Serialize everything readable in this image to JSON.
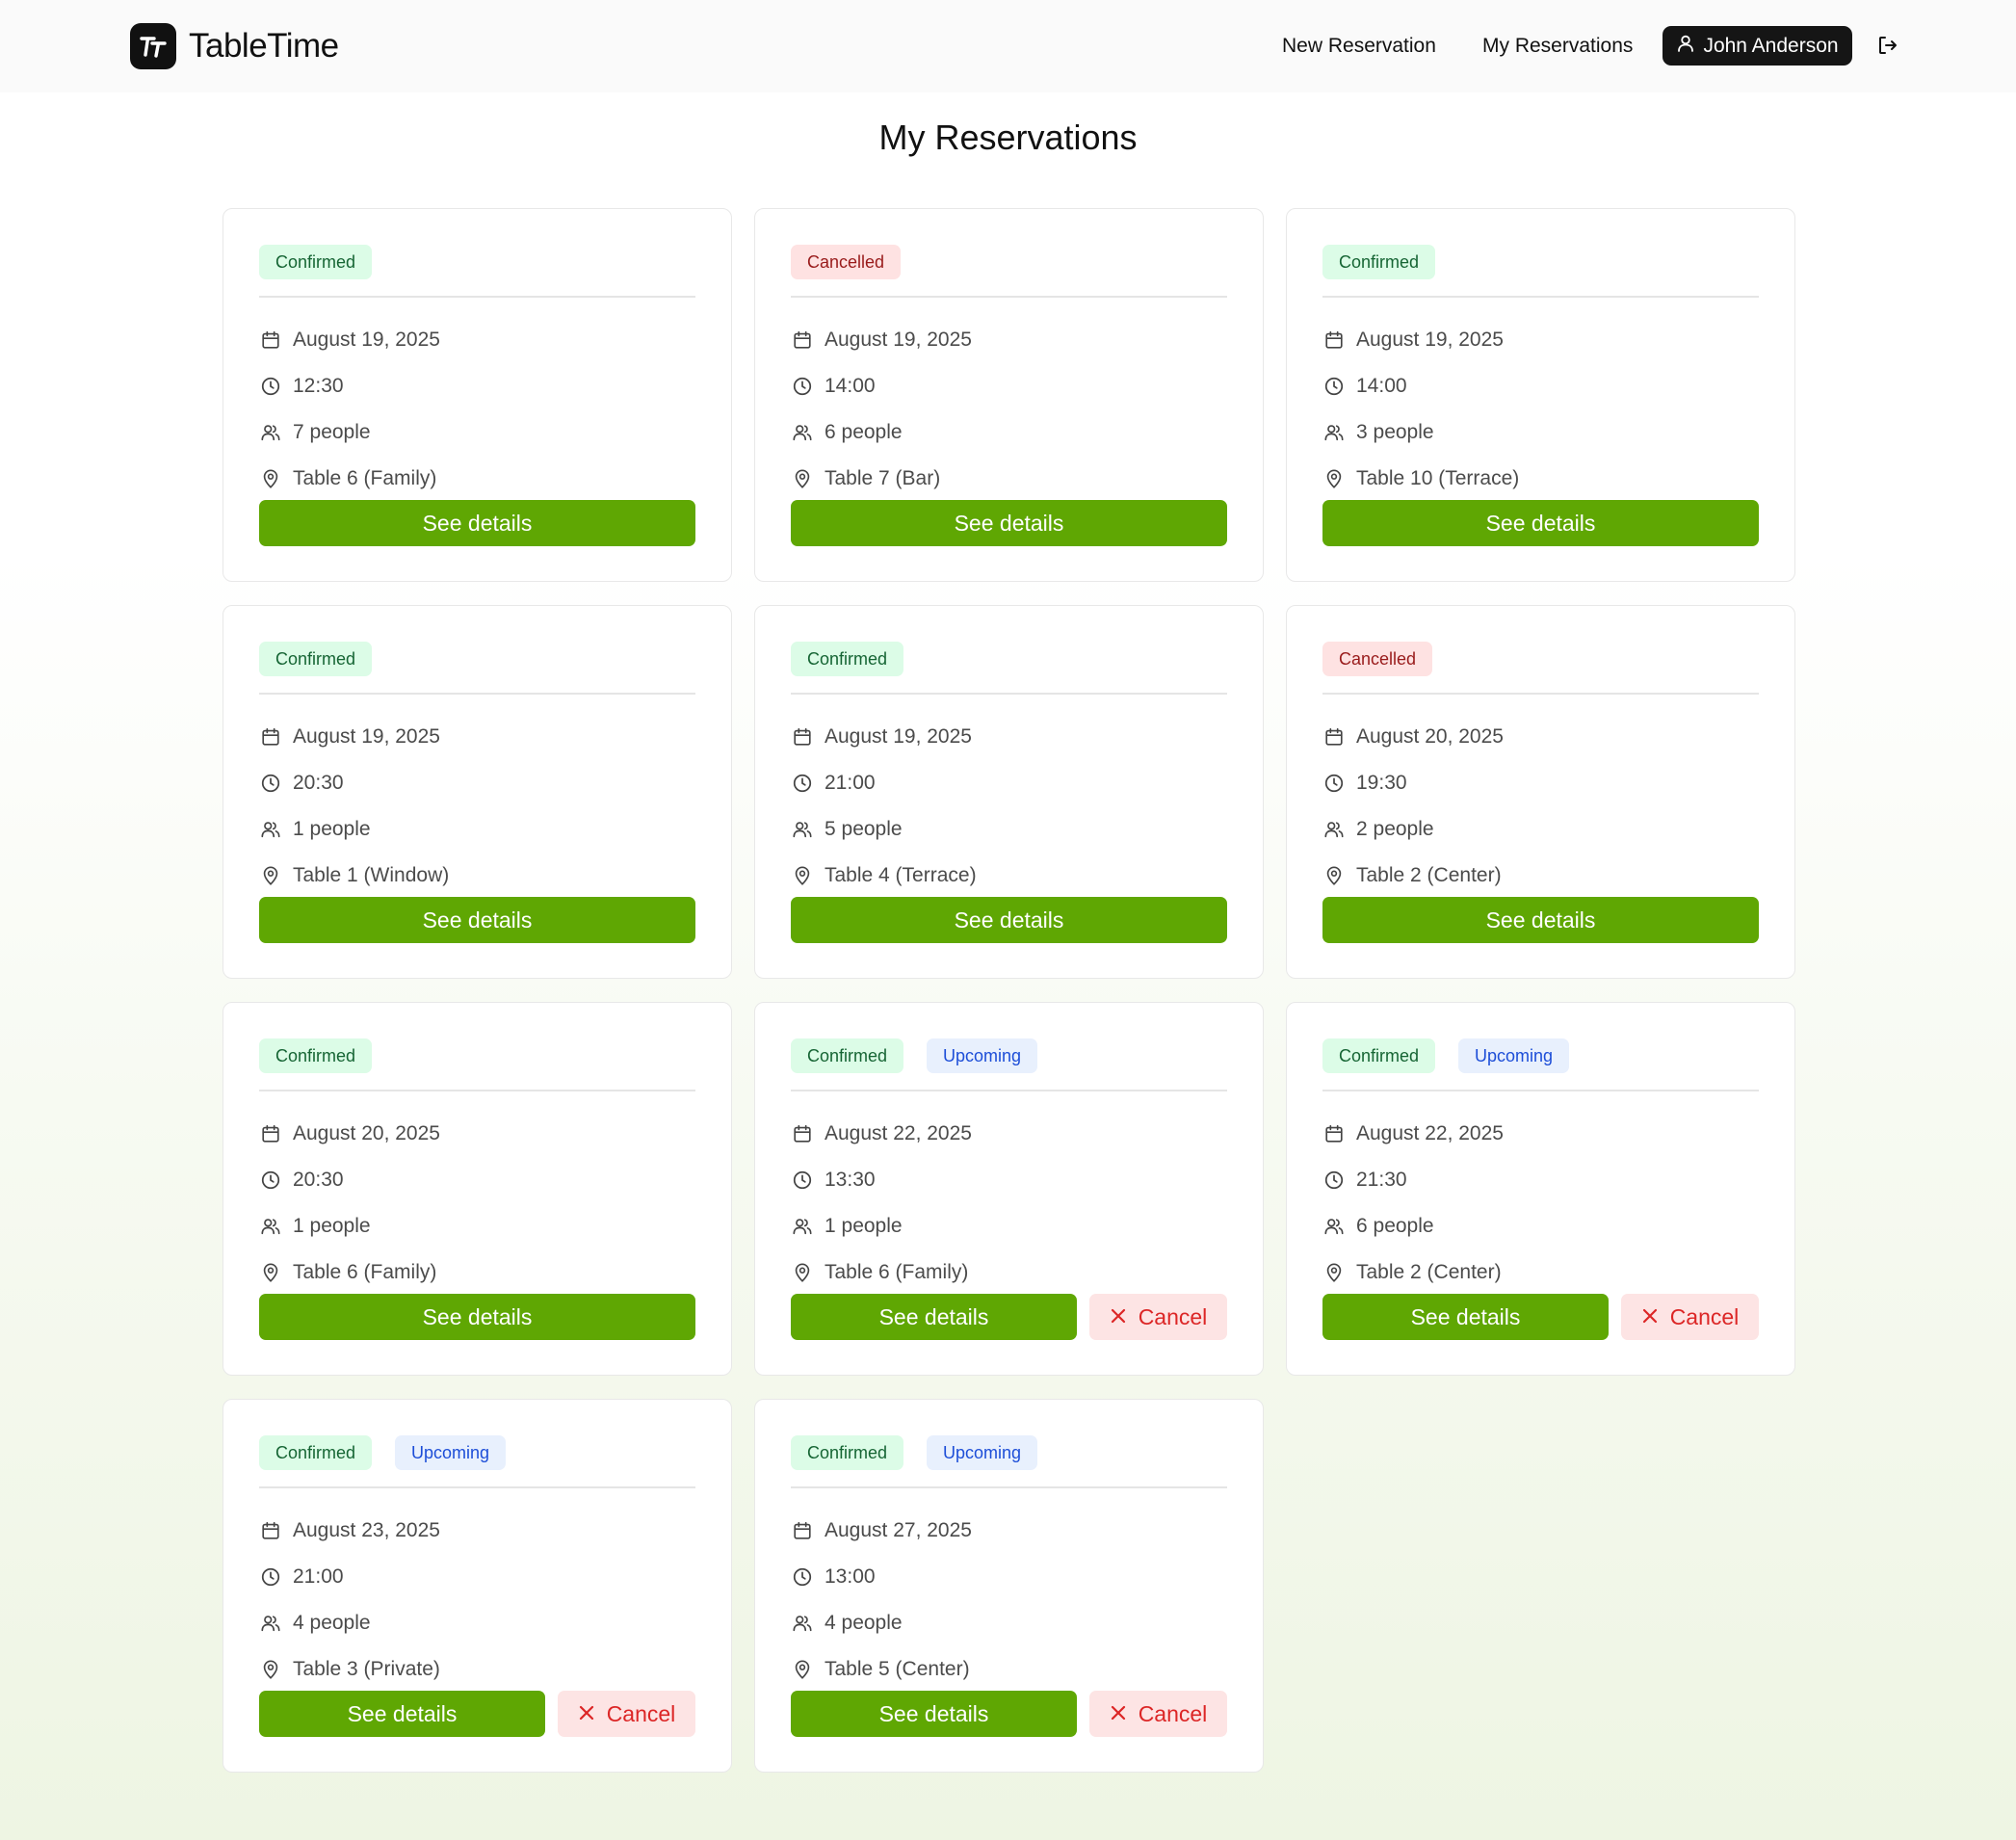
{
  "header": {
    "brand": "TableTime",
    "nav_new": "New Reservation",
    "nav_my": "My Reservations",
    "user": "John Anderson"
  },
  "page": {
    "title": "My Reservations"
  },
  "labels": {
    "see_details": "See details",
    "cancel": "Cancel"
  },
  "colors": {
    "accent": "#5fa703",
    "confirmed_bg": "#dcfce7",
    "cancelled_bg": "#fee2e2",
    "upcoming_bg": "#e8f0fd",
    "cancel_text": "#dc2626"
  },
  "reservations": [
    {
      "status": "Confirmed",
      "status_type": "confirmed",
      "upcoming": "",
      "date": "August 19, 2025",
      "time": "12:30",
      "people": "7 people",
      "table": "Table 6 (Family)",
      "cancellable": false
    },
    {
      "status": "Cancelled",
      "status_type": "cancelled",
      "upcoming": "",
      "date": "August 19, 2025",
      "time": "14:00",
      "people": "6 people",
      "table": "Table 7 (Bar)",
      "cancellable": false
    },
    {
      "status": "Confirmed",
      "status_type": "confirmed",
      "upcoming": "",
      "date": "August 19, 2025",
      "time": "14:00",
      "people": "3 people",
      "table": "Table 10 (Terrace)",
      "cancellable": false
    },
    {
      "status": "Confirmed",
      "status_type": "confirmed",
      "upcoming": "",
      "date": "August 19, 2025",
      "time": "20:30",
      "people": "1 people",
      "table": "Table 1 (Window)",
      "cancellable": false
    },
    {
      "status": "Confirmed",
      "status_type": "confirmed",
      "upcoming": "",
      "date": "August 19, 2025",
      "time": "21:00",
      "people": "5 people",
      "table": "Table 4 (Terrace)",
      "cancellable": false
    },
    {
      "status": "Cancelled",
      "status_type": "cancelled",
      "upcoming": "",
      "date": "August 20, 2025",
      "time": "19:30",
      "people": "2 people",
      "table": "Table 2 (Center)",
      "cancellable": false
    },
    {
      "status": "Confirmed",
      "status_type": "confirmed",
      "upcoming": "",
      "date": "August 20, 2025",
      "time": "20:30",
      "people": "1 people",
      "table": "Table 6 (Family)",
      "cancellable": false
    },
    {
      "status": "Confirmed",
      "status_type": "confirmed",
      "upcoming": "Upcoming",
      "date": "August 22, 2025",
      "time": "13:30",
      "people": "1 people",
      "table": "Table 6 (Family)",
      "cancellable": true
    },
    {
      "status": "Confirmed",
      "status_type": "confirmed",
      "upcoming": "Upcoming",
      "date": "August 22, 2025",
      "time": "21:30",
      "people": "6 people",
      "table": "Table 2 (Center)",
      "cancellable": true
    },
    {
      "status": "Confirmed",
      "status_type": "confirmed",
      "upcoming": "Upcoming",
      "date": "August 23, 2025",
      "time": "21:00",
      "people": "4 people",
      "table": "Table 3 (Private)",
      "cancellable": true
    },
    {
      "status": "Confirmed",
      "status_type": "confirmed",
      "upcoming": "Upcoming",
      "date": "August 27, 2025",
      "time": "13:00",
      "people": "4 people",
      "table": "Table 5 (Center)",
      "cancellable": true
    }
  ]
}
